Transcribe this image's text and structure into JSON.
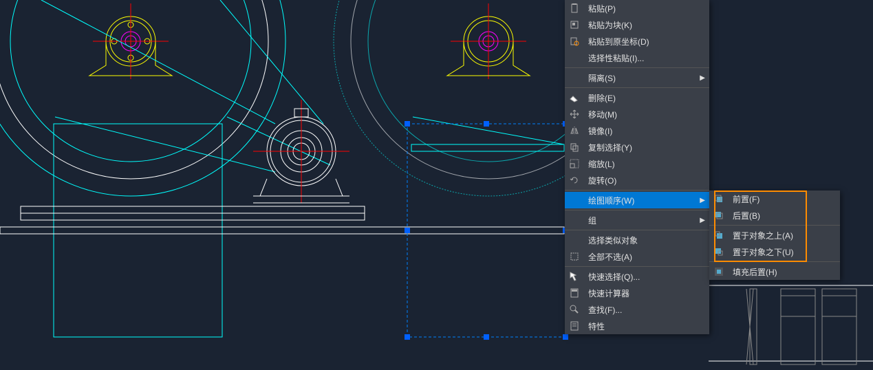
{
  "contextMenu": {
    "paste": "粘贴(P)",
    "pasteAsBlock": "粘贴为块(K)",
    "pasteToOriginal": "粘贴到原坐标(D)",
    "pasteSpecial": "选择性粘贴(I)...",
    "isolate": "隔离(S)",
    "delete": "删除(E)",
    "move": "移动(M)",
    "mirror": "镜像(I)",
    "copySelection": "复制选择(Y)",
    "scale": "缩放(L)",
    "rotate": "旋转(O)",
    "drawOrder": "绘图顺序(W)",
    "group": "组",
    "selectSimilar": "选择类似对象",
    "deselectAll": "全部不选(A)",
    "quickSelect": "快速选择(Q)...",
    "quickCalc": "快速计算器",
    "find": "查找(F)...",
    "properties": "特性"
  },
  "submenu": {
    "bringToFront": "前置(F)",
    "sendToBack": "后置(B)",
    "bringAbove": "置于对象之上(A)",
    "sendBelow": "置于对象之下(U)",
    "fillBehind": "填充后置(H)"
  }
}
